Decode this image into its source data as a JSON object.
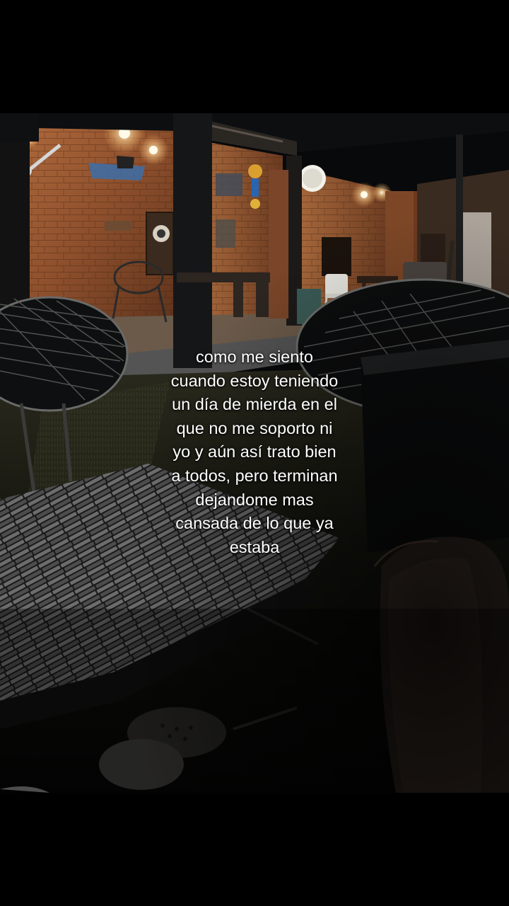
{
  "caption": {
    "text": "como me siento\ncuando estoy teniendo\nun día de mierda en el\nque no me soporto ni\nyo y aún así trato bien\na todos, pero terminan\ndejandome mas\ncansada de lo que ya\nestaba"
  },
  "scene": {
    "description_icons": [
      "string-chair-icon",
      "dartboard-icon",
      "wall-light-icon",
      "sign-icon",
      "woven-table-icon"
    ],
    "colors": {
      "background": "#000000",
      "brick": "#9a5a32",
      "light": "#ffe8b8",
      "caption_text": "#ffffff"
    }
  }
}
